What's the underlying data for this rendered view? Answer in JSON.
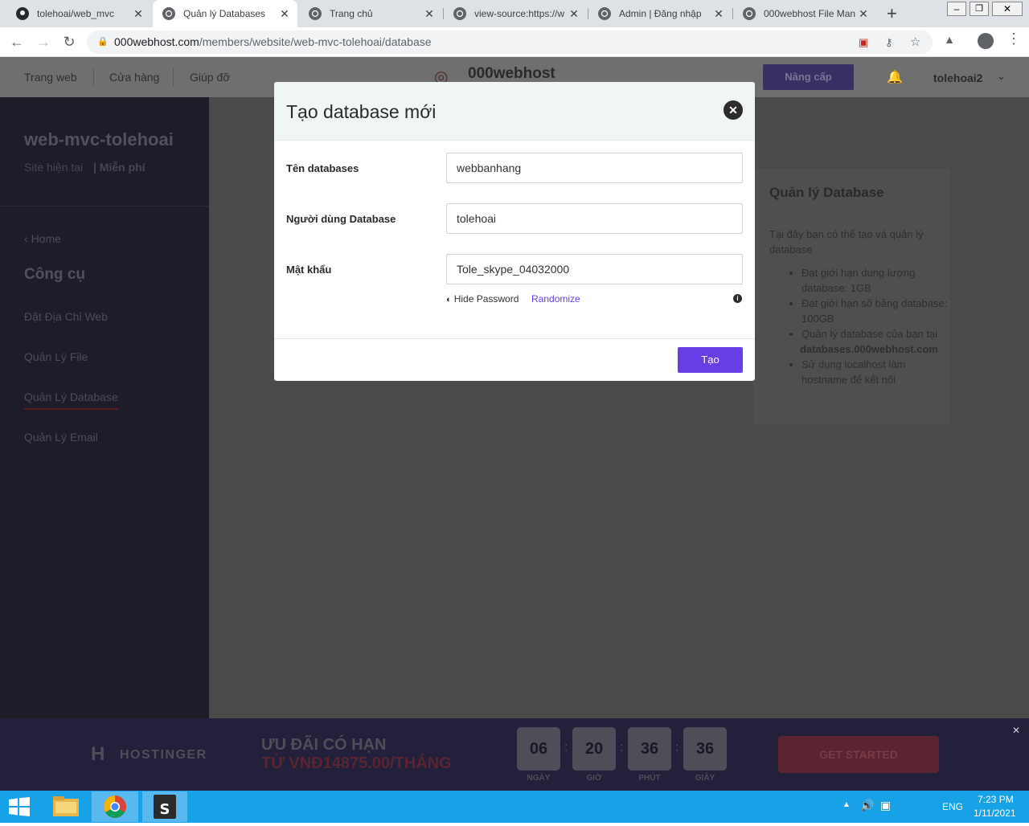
{
  "browser": {
    "tabs": [
      {
        "label": "tolehoai/web_mvc",
        "icon": "github-icon",
        "active": false
      },
      {
        "label": "Quản lý Databases",
        "icon": "globe-icon",
        "active": true
      },
      {
        "label": "Trang chủ",
        "icon": "globe-icon",
        "active": false
      },
      {
        "label": "view-source:https://w",
        "icon": "globe-icon",
        "active": false
      },
      {
        "label": "Admin | Đăng nhập",
        "icon": "globe-icon",
        "active": false
      },
      {
        "label": "000webhost File Man",
        "icon": "globe-icon",
        "active": false
      }
    ],
    "url_host": "000webhost.com",
    "url_path": "/members/website/web-mvc-tolehoai/database"
  },
  "header": {
    "nav": [
      "Trang web",
      "Cửa hàng",
      "Giúp đỡ"
    ],
    "logo": "000webhost",
    "upgrade_label": "Nâng cấp",
    "username": "tolehoai2"
  },
  "sidebar": {
    "site_name": "web-mvc-tolehoai",
    "site_label": "Site hiện tại",
    "plan": "| Miễn phí",
    "home": "Home",
    "section": "Công cụ",
    "items": [
      "Đặt Địa Chỉ Web",
      "Quản Lý File",
      "Quản Lý Database",
      "Quản Lý Email"
    ],
    "active_index": 2
  },
  "info": {
    "title": "Quản lý Database",
    "desc": "Tại đây bạn có thể tạo và quản lý database",
    "bullets": [
      "Đạt giới hạn dung lượng database: 1GB",
      "Đạt giới hạn số bảng database: 100GB",
      "Quản lý database của bạn tại",
      "databases.000webhost.com",
      "Sử dụng localhost làm hostname để kết nối"
    ]
  },
  "modal": {
    "title": "Tạo database mới",
    "fields": [
      {
        "label": "Tên databases",
        "value": "webbanhang"
      },
      {
        "label": "Người dùng Database",
        "value": "tolehoai"
      },
      {
        "label": "Mật khẩu",
        "value": "Tole_skype_04032000"
      }
    ],
    "hide_password": "Hide Password",
    "randomize": "Randomize",
    "create_label": "Tạo"
  },
  "promo": {
    "brand": "HOSTINGER",
    "line1": "ƯU ĐÃI CÓ HẠN",
    "line2": "TỪ VNĐ14875.00/THÁNG",
    "countdown": [
      {
        "value": "06",
        "label": "NGÀY"
      },
      {
        "value": "20",
        "label": "GIỜ"
      },
      {
        "value": "36",
        "label": "PHÚT"
      },
      {
        "value": "36",
        "label": "GIÂY"
      }
    ],
    "cta": "GET STARTED"
  },
  "taskbar": {
    "lang": "ENG",
    "time": "7:23 PM",
    "date": "1/11/2021"
  },
  "colors": {
    "accent": "#673de6",
    "taskbar": "#17a1e7",
    "sidebar": "#1e1c28"
  }
}
